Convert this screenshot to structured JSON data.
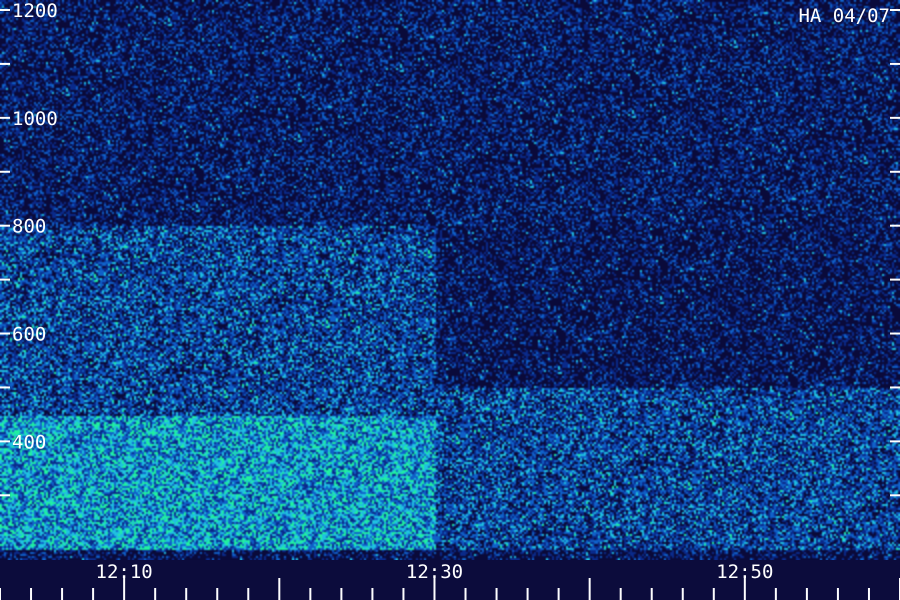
{
  "chart_data": {
    "type": "heatmap",
    "title": "",
    "station_label": "HA 04/07",
    "xlabel": "",
    "ylabel": "",
    "x_tick_labels": [
      "12:10",
      "12:30",
      "12:50"
    ],
    "x_range": [
      "12:02",
      "13:00"
    ],
    "x_minor_tick_minutes": 2,
    "y_ticks": [
      1200,
      1000,
      800,
      600,
      400
    ],
    "y_range": [
      180,
      1200
    ],
    "y_minor_tick_step": 100,
    "grid": false,
    "colormap": [
      "#0a0a3a",
      "#0a2a8a",
      "#1060c8",
      "#20c0e0",
      "#20f0a0"
    ],
    "description_of_intensity": [
      {
        "time_range": [
          "12:02",
          "12:30"
        ],
        "freq_range": [
          200,
          450
        ],
        "level": "high"
      },
      {
        "time_range": [
          "12:02",
          "12:30"
        ],
        "freq_range": [
          450,
          800
        ],
        "level": "medium"
      },
      {
        "time_range": [
          "12:30",
          "13:00"
        ],
        "freq_range": [
          200,
          500
        ],
        "level": "medium"
      },
      {
        "time_range": [
          "12:02",
          "13:00"
        ],
        "freq_range": [
          800,
          1200
        ],
        "level": "low"
      }
    ]
  }
}
